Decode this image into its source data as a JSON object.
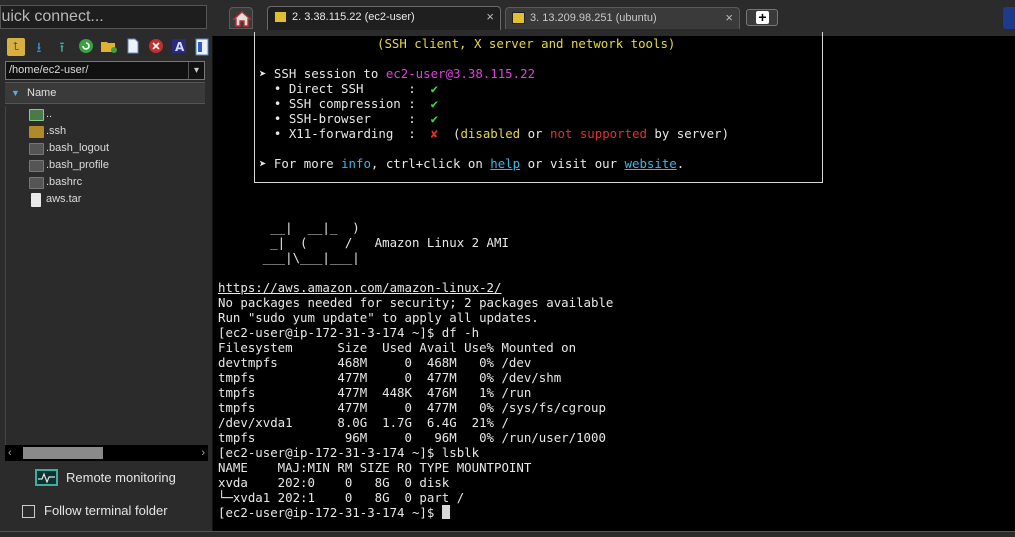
{
  "quick_connect": {
    "placeholder": "Quick connect..."
  },
  "tabs": [
    {
      "label": "2. 3.38.115.22 (ec2-user)",
      "close": "×",
      "active": true
    },
    {
      "label": "3. 13.209.98.251 (ubuntu)",
      "close": "×",
      "active": false
    }
  ],
  "new_tab_label": "+",
  "sidebar": {
    "path": "/home/ec2-user/",
    "path_dropdown": "▾",
    "column_header": "Name",
    "files": [
      {
        "name": "..",
        "icon": "parent-folder-icon"
      },
      {
        "name": ".ssh",
        "icon": "folder-icon"
      },
      {
        "name": ".bash_logout",
        "icon": "file-icon"
      },
      {
        "name": ".bash_profile",
        "icon": "file-icon"
      },
      {
        "name": ".bashrc",
        "icon": "file-icon"
      },
      {
        "name": "aws.tar",
        "icon": "archive-icon"
      }
    ],
    "remote_monitoring": "Remote monitoring",
    "follow_terminal_folder": "Follow terminal folder",
    "follow_checked": false
  },
  "terminal": {
    "banner": {
      "tools_line": "(SSH client, X server and network tools)",
      "session_prefix": "➤ SSH session to ",
      "session_target": "ec2-user@3.38.115.22",
      "features": [
        {
          "label": "• Direct SSH      :",
          "status": "✔",
          "ok": true
        },
        {
          "label": "• SSH compression :",
          "status": "✔",
          "ok": true
        },
        {
          "label": "• SSH-browser     :",
          "status": "✔",
          "ok": true
        },
        {
          "label": "• X11-forwarding  :",
          "status": "✘",
          "ok": false
        }
      ],
      "x11_note": {
        "open": "(",
        "disabled": "disabled",
        "or": " or ",
        "not_supported": "not supported",
        "tail": " by server)"
      },
      "more_info": {
        "prefix": "➤ For more ",
        "info": "info",
        "mid": ", ctrl+click on ",
        "help": "help",
        "mid2": " or visit our ",
        "website": "website",
        "end": "."
      }
    },
    "ascii_logo": [
      "       __|  __|_  )",
      "       _|  (     /   Amazon Linux 2 AMI",
      "      ___|\\___|___|"
    ],
    "lines": [
      "https://aws.amazon.com/amazon-linux-2/",
      "No packages needed for security; 2 packages available",
      "Run \"sudo yum update\" to apply all updates.",
      "[ec2-user@ip-172-31-3-174 ~]$ df -h",
      "Filesystem      Size  Used Avail Use% Mounted on",
      "devtmpfs        468M     0  468M   0% /dev",
      "tmpfs           477M     0  477M   0% /dev/shm",
      "tmpfs           477M  448K  476M   1% /run",
      "tmpfs           477M     0  477M   0% /sys/fs/cgroup",
      "/dev/xvda1      8.0G  1.7G  6.4G  21% /",
      "tmpfs            96M     0   96M   0% /run/user/1000",
      "[ec2-user@ip-172-31-3-174 ~]$ lsblk",
      "NAME    MAJ:MIN RM SIZE RO TYPE MOUNTPOINT",
      "xvda    202:0    0   8G  0 disk",
      "└─xvda1 202:1    0   8G  0 part /",
      "[ec2-user@ip-172-31-3-174 ~]$ "
    ]
  },
  "colors": {
    "accent_yellow": "#e8d840",
    "session_magenta": "#e040e0",
    "ok_green": "#3ad83a",
    "fail_red": "#e03030",
    "link_cyan": "#3ab8e8"
  }
}
